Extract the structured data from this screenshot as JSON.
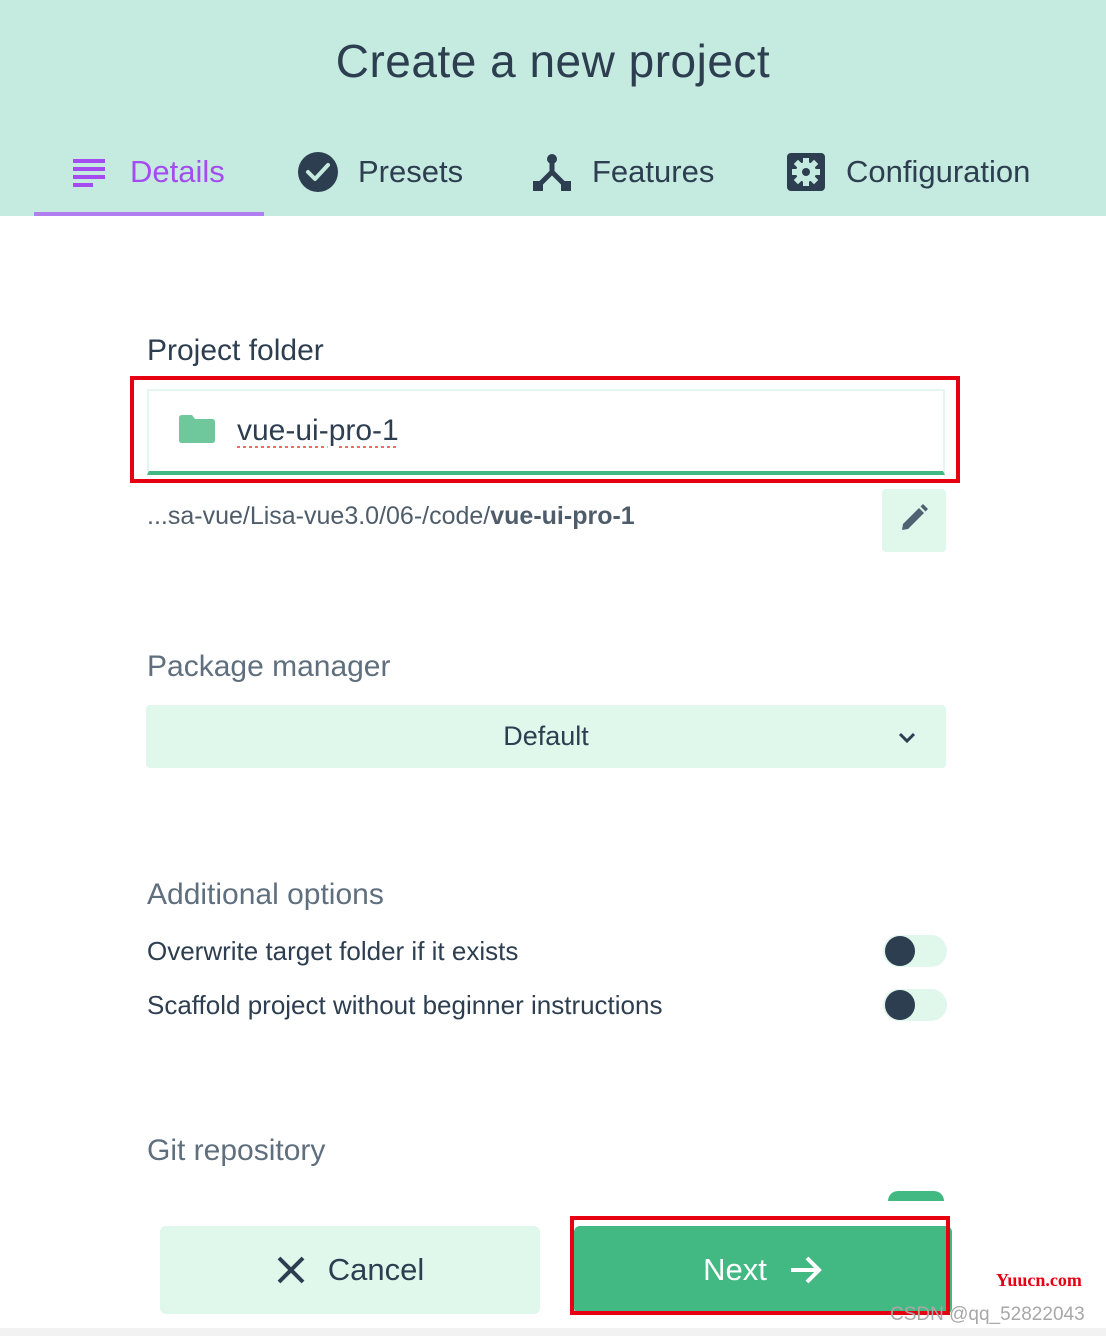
{
  "header": {
    "title": "Create a new project",
    "tabs": [
      {
        "label": "Details",
        "icon": "list-icon",
        "active": true
      },
      {
        "label": "Presets",
        "icon": "check-circle-icon",
        "active": false
      },
      {
        "label": "Features",
        "icon": "call-split-icon",
        "active": false
      },
      {
        "label": "Configuration",
        "icon": "settings-gear-icon",
        "active": false
      }
    ]
  },
  "colors": {
    "header_bg": "#c5eadf",
    "accent_purple": "#a44cf0",
    "primary_green": "#42b983",
    "light_green": "#e0f7ec",
    "text_dark": "#2c3e50",
    "highlight_red": "#e60012"
  },
  "project_folder": {
    "label": "Project folder",
    "value": "vue-ui-pro-1",
    "folder_icon": "folder-icon",
    "path_prefix": "...sa-vue/Lisa-vue3.0/06-/code/",
    "path_name": "vue-ui-pro-1",
    "edit_icon": "pencil-icon"
  },
  "package_manager": {
    "label": "Package manager",
    "selected": "Default"
  },
  "additional_options": {
    "label": "Additional options",
    "options": [
      {
        "label": "Overwrite target folder if it exists",
        "enabled": false
      },
      {
        "label": "Scaffold project without beginner instructions",
        "enabled": false
      }
    ]
  },
  "git": {
    "label": "Git repository"
  },
  "footer": {
    "cancel_label": "Cancel",
    "next_label": "Next"
  },
  "watermarks": {
    "site": "Yuucn.com",
    "author": "CSDN @qq_52822043"
  }
}
